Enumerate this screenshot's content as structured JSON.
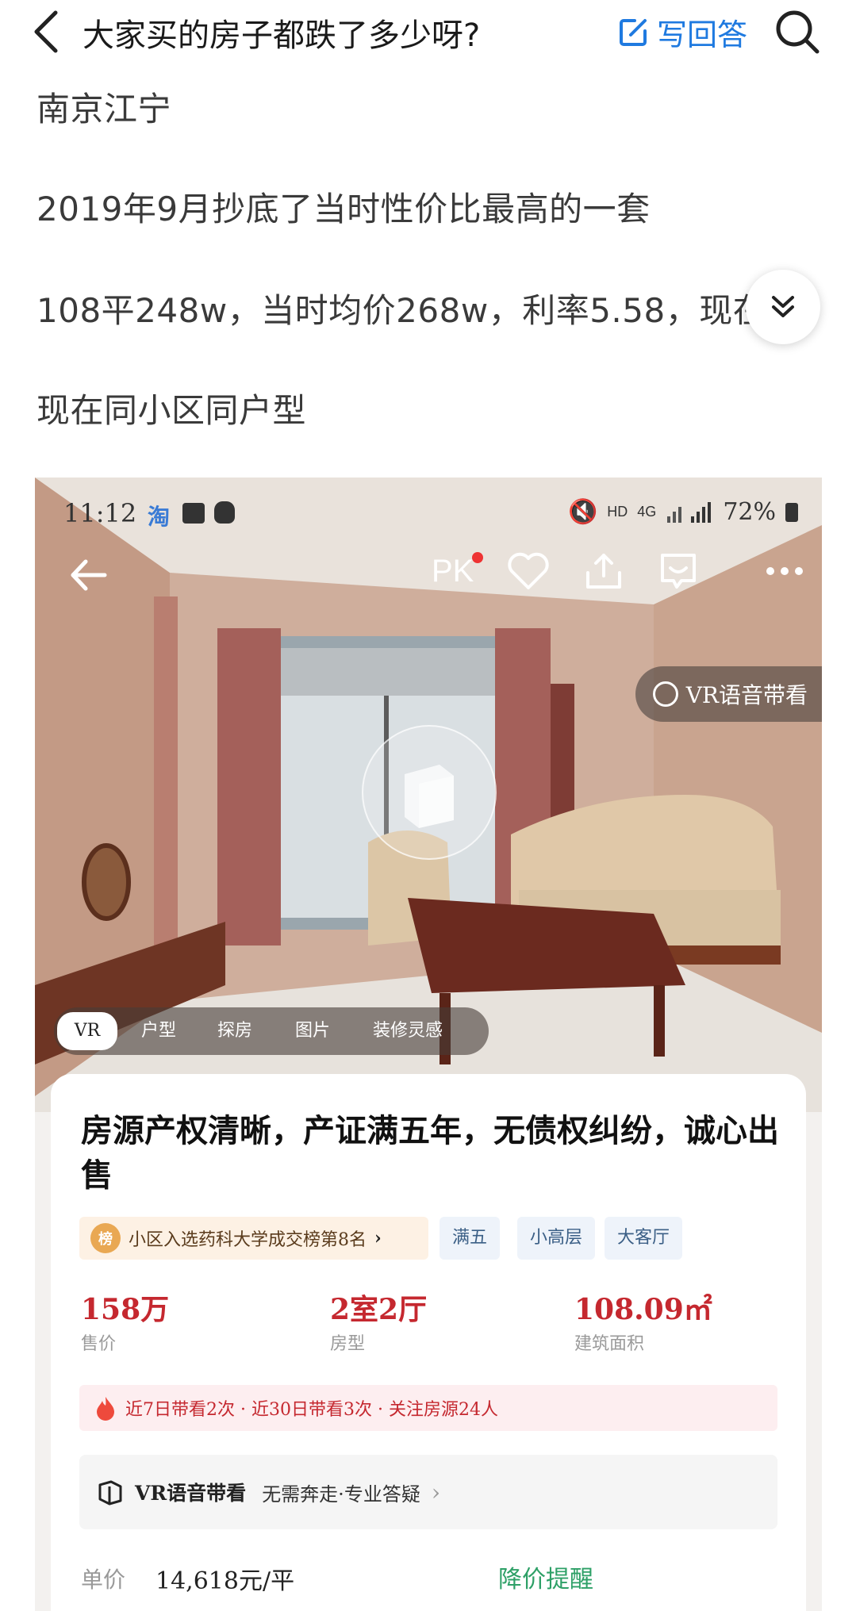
{
  "header": {
    "question_title": "大家买的房子都跌了多少呀?",
    "write_answer_label": "写回答"
  },
  "answer": {
    "lines": [
      "南京江宁",
      "2019年9月抄底了当时性价比最高的一套",
      "108平248w，当时均价268w，利率5.58，现在",
      "现在同小区同户型"
    ]
  },
  "embedded_app": {
    "status_bar": {
      "time": "11:12",
      "app_icon_text": "淘",
      "network": "HD",
      "signal_type": "4G",
      "battery": "72%"
    },
    "nav": {
      "pk_label": "PK"
    },
    "vr_guide_label": "VR语音带看",
    "media_tabs": [
      "VR",
      "户型",
      "探房",
      "图片",
      "装修灵感"
    ],
    "listing": {
      "title": "房源产权清晰，产证满五年，无债权纠纷，诚心出售",
      "rank_badge_icon": "榜",
      "rank_badge_text": "小区入选药科大学成交榜第8名",
      "tags": [
        "满五",
        "小高层",
        "大客厅"
      ],
      "stats": [
        {
          "value": "158万",
          "label": "售价"
        },
        {
          "value": "2室2厅",
          "label": "房型"
        },
        {
          "value": "108.09㎡",
          "label": "建筑面积"
        }
      ],
      "activity_text": "近7日带看2次 · 近30日带看3次 · 关注房源24人",
      "vr_row": {
        "title": "VR语音带看",
        "subtitle": "无需奔走·专业答疑"
      },
      "unit_price_label": "单价",
      "unit_price_value": "14,618元/平",
      "price_alert_label": "降价提醒"
    }
  },
  "colors": {
    "accent_blue": "#1f7ae0",
    "price_red": "#c5282f",
    "alert_green": "#2ea067"
  }
}
